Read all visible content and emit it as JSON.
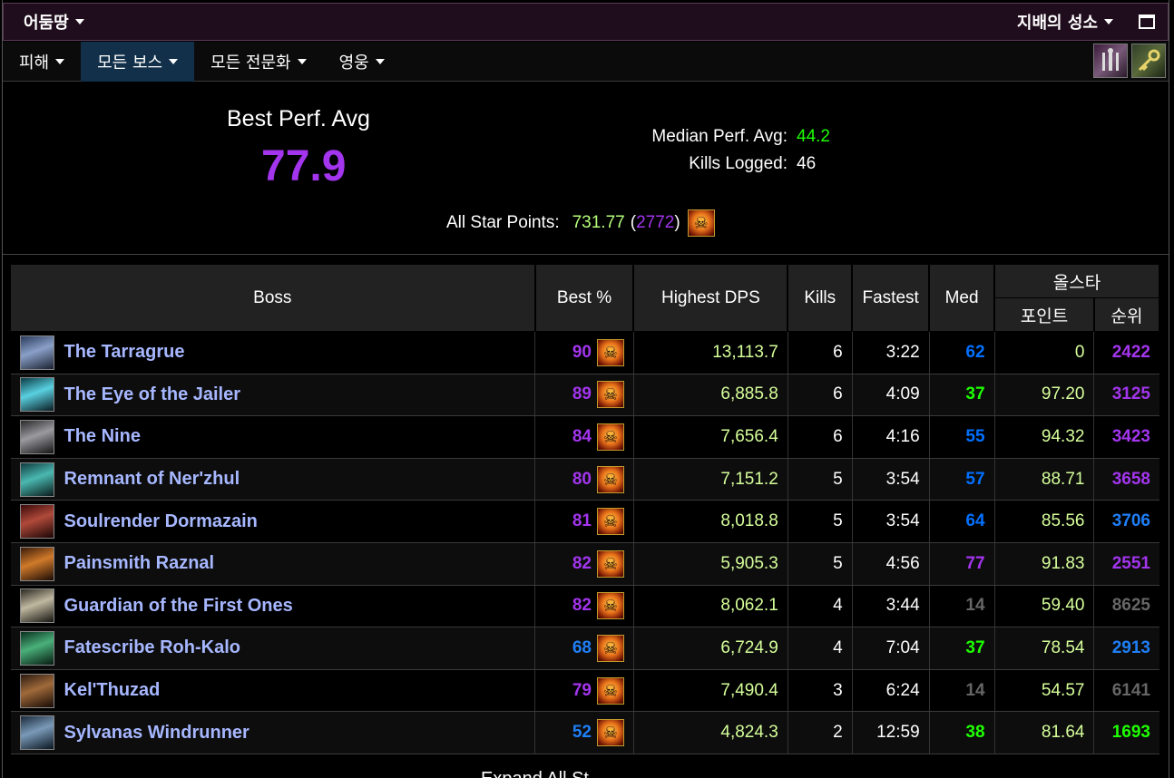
{
  "topbar": {
    "region": "어둠땅",
    "zone": "지배의 성소"
  },
  "nav": {
    "items": [
      {
        "label": "피해",
        "active": false
      },
      {
        "label": "모든 보스",
        "active": true
      },
      {
        "label": "모든 전문화",
        "active": false
      },
      {
        "label": "영웅",
        "active": false
      }
    ]
  },
  "summary": {
    "best_label": "Best Perf. Avg",
    "best_value": "77.9",
    "median_label": "Median Perf. Avg:",
    "median_value": "44.2",
    "kills_label": "Kills Logged:",
    "kills_value": "46",
    "allstar_label": "All Star Points:",
    "allstar_points": "731.77",
    "allstar_rank": "2772"
  },
  "table": {
    "headers": {
      "boss": "Boss",
      "best": "Best %",
      "dps": "Highest DPS",
      "kills": "Kills",
      "fastest": "Fastest",
      "med": "Med",
      "allstar": "올스타",
      "points": "포인트",
      "rank": "순위"
    },
    "rows": [
      {
        "boss": "The Tarragrue",
        "best": "90",
        "dps": "13,113.7",
        "kills": "6",
        "fastest": "3:22",
        "med": "62",
        "points": "0",
        "rank": "2422"
      },
      {
        "boss": "The Eye of the Jailer",
        "best": "89",
        "dps": "6,885.8",
        "kills": "6",
        "fastest": "4:09",
        "med": "37",
        "points": "97.20",
        "rank": "3125"
      },
      {
        "boss": "The Nine",
        "best": "84",
        "dps": "7,656.4",
        "kills": "6",
        "fastest": "4:16",
        "med": "55",
        "points": "94.32",
        "rank": "3423"
      },
      {
        "boss": "Remnant of Ner'zhul",
        "best": "80",
        "dps": "7,151.2",
        "kills": "5",
        "fastest": "3:54",
        "med": "57",
        "points": "88.71",
        "rank": "3658"
      },
      {
        "boss": "Soulrender Dormazain",
        "best": "81",
        "dps": "8,018.8",
        "kills": "5",
        "fastest": "3:54",
        "med": "64",
        "points": "85.56",
        "rank": "3706"
      },
      {
        "boss": "Painsmith Raznal",
        "best": "82",
        "dps": "5,905.3",
        "kills": "5",
        "fastest": "4:56",
        "med": "77",
        "points": "91.83",
        "rank": "2551"
      },
      {
        "boss": "Guardian of the First Ones",
        "best": "82",
        "dps": "8,062.1",
        "kills": "4",
        "fastest": "3:44",
        "med": "14",
        "points": "59.40",
        "rank": "8625"
      },
      {
        "boss": "Fatescribe Roh-Kalo",
        "best": "68",
        "dps": "6,724.9",
        "kills": "4",
        "fastest": "7:04",
        "med": "37",
        "points": "78.54",
        "rank": "2913"
      },
      {
        "boss": "Kel'Thuzad",
        "best": "79",
        "dps": "7,490.4",
        "kills": "3",
        "fastest": "6:24",
        "med": "14",
        "points": "54.57",
        "rank": "6141"
      },
      {
        "boss": "Sylvanas Windrunner",
        "best": "52",
        "dps": "4,824.3",
        "kills": "2",
        "fastest": "12:59",
        "med": "38",
        "points": "81.64",
        "rank": "1693"
      }
    ]
  },
  "colors": {
    "purple": "#a335ee",
    "blue": "#0070ff",
    "green": "#1eff00",
    "gray": "#666666",
    "boss_name": "#a6b7ff",
    "lime": "#d6ff9a"
  },
  "footer": {
    "text": "Expand    All St"
  }
}
